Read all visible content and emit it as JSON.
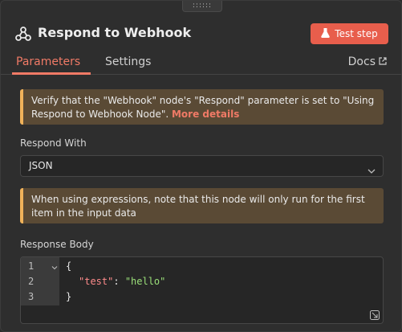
{
  "drag_handle": "::::::",
  "header": {
    "title": "Respond to Webhook",
    "test_button_label": "Test step",
    "node_icon": "webhook-icon",
    "flask_icon": "flask-icon"
  },
  "tabs": {
    "items": [
      {
        "label": "Parameters",
        "active": true
      },
      {
        "label": "Settings",
        "active": false
      }
    ],
    "docs_label": "Docs",
    "docs_icon": "external-link-icon"
  },
  "notice1": {
    "text": "Verify that the \"Webhook\" node's \"Respond\" parameter is set to \"Using Respond to Webhook Node\". ",
    "link": "More details"
  },
  "respond_with": {
    "label": "Respond With",
    "value": "JSON"
  },
  "notice2": {
    "text": "When using expressions, note that this node will only run for the first item in the input data"
  },
  "response_body": {
    "label": "Response Body",
    "line_numbers": [
      "1",
      "2",
      "3"
    ],
    "lines": [
      {
        "open": "{"
      },
      {
        "key": "\"test\"",
        "sep": ": ",
        "value": "\"hello\""
      },
      {
        "close": "}"
      }
    ]
  },
  "colors": {
    "accent": "#e85e4c",
    "tab_active": "#f07a66",
    "notice_bg": "#5a4a35",
    "notice_border": "#f0b25a",
    "json_key": "#ff8b8b",
    "json_string": "#9be07a"
  }
}
